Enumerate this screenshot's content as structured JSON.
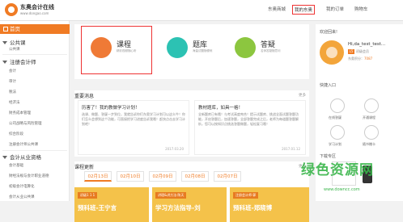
{
  "header": {
    "logo_title": "东奥会计在线",
    "logo_sub": "www.dongao.com",
    "nav": [
      "东奥商城",
      "我的东奥",
      "我的订单",
      "购物车"
    ]
  },
  "sidebar": {
    "home": "首页",
    "sections": [
      {
        "title": "公共课",
        "items": [
          "公共课"
        ]
      },
      {
        "title": "注册会计师",
        "items": [
          "会计",
          "审计",
          "税法",
          "经济法",
          "财务成本管理",
          "公司战略与风险管理",
          "综合阶段",
          "注册会计师公共课"
        ]
      },
      {
        "title": "会计从业资格",
        "items": [
          "会计基础",
          "财经法规与会计职业道德",
          "初级会计电算化",
          "会计从业公共课"
        ]
      }
    ]
  },
  "cards": [
    {
      "title": "课程",
      "sub": "精彩视频随心听"
    },
    {
      "title": "题库",
      "sub": "海量试题随便练"
    },
    {
      "title": "答疑",
      "sub": "名师答疑随意问"
    }
  ],
  "notice": {
    "title": "重要消息",
    "more": "更多",
    "items": [
      {
        "title": "历害了！我的教做学习计划！",
        "body": "选课、做题、答疑一步到位，我就告诉你们东奥学习计划可以这么牛！你们怎么会想到这个功能，可直接把学习进度告诉我哦！赶快点击去学习计划吧！",
        "date": "2017.03.20"
      },
      {
        "title": "教材题库，如具一格！",
        "body": "全新题库已有哦！与考试高度吻合！提示试题库、挑战全面试题答题功能，开启答题后，加速答题，全部答题完成之后，老师为每道题答题解析，您可以按知识点挑选答题做题，轻松复习哦！",
        "date": "2017.01.12"
      }
    ]
  },
  "updates": {
    "title": "课程更新",
    "more": "更多",
    "tabs": [
      "02月13日",
      "02月10日",
      "02月09日",
      "02月08日",
      "02月07日"
    ],
    "courses": [
      {
        "tag": "初级1 1 1",
        "title": "预科班-王宁言"
      },
      {
        "tag": "讲理&讲方法·陈天",
        "title": "学习方法指导-刘"
      },
      {
        "tag": "注册会计师·郭",
        "title": "预科班-郑晓博"
      }
    ]
  },
  "profile": {
    "welcome": "欢迎回来!",
    "name": "Hi,da_test_test...",
    "badge": "L5",
    "badge_text": "初级会员",
    "points_label": "东奥积分：",
    "points_value": "7087"
  },
  "quick": {
    "title": "快捷入口",
    "items": [
      "在线答疑",
      "开通课程",
      "学习计划",
      "随书赠卡"
    ]
  },
  "download": {
    "title": "下载专区"
  },
  "watermark": {
    "text": "绿色资源网",
    "url": "www.downcc.com"
  }
}
